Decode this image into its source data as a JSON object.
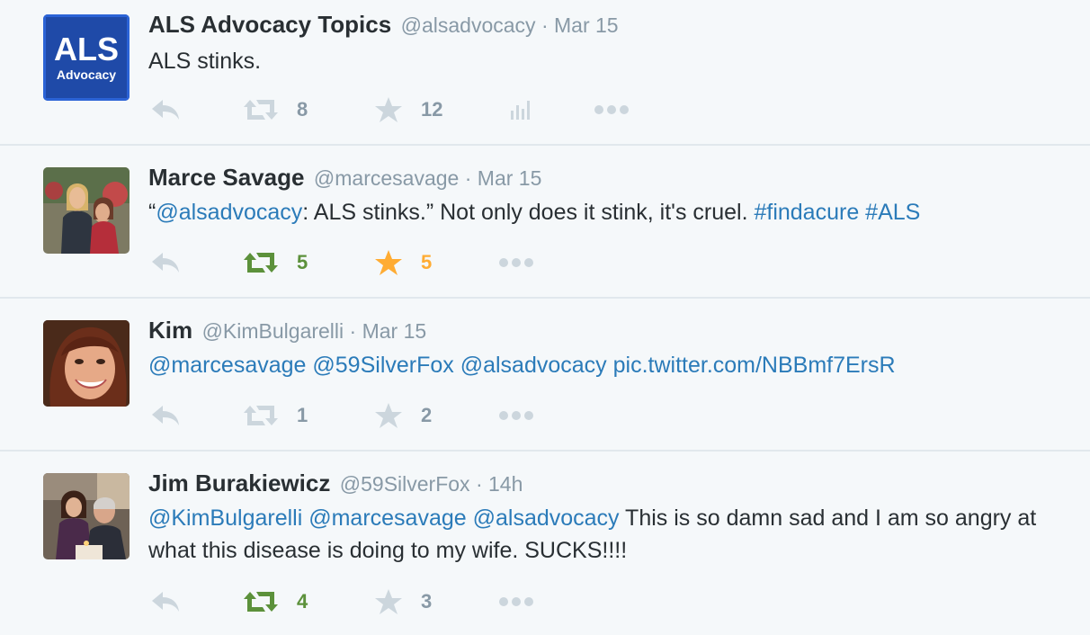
{
  "tweets": [
    {
      "name": "ALS Advocacy Topics",
      "handle": "@alsadvocacy",
      "date": "Mar 15",
      "logo_text": "ALS",
      "logo_subtext": "Advocacy",
      "text": "ALS stinks.",
      "retweets": "8",
      "favorites": "12",
      "retweeted": false,
      "favorited": false
    },
    {
      "name": "Marce Savage",
      "handle": "@marcesavage",
      "date": "Mar 15",
      "text_open_quote": "“",
      "text_mention": "@alsadvocacy",
      "text_mid": ": ALS stinks.” Not only does it stink, it's cruel. ",
      "text_tag1": "#findacure",
      "text_space": " ",
      "text_tag2": "#ALS",
      "retweets": "5",
      "favorites": "5",
      "retweeted": true,
      "favorited": true
    },
    {
      "name": "Kim",
      "handle": "@KimBulgarelli",
      "date": "Mar 15",
      "text_line": "@marcesavage @59SilverFox @alsadvocacy pic.twitter.com/NBBmf7ErsR",
      "retweets": "1",
      "favorites": "2",
      "retweeted": false,
      "favorited": false
    },
    {
      "name": "Jim Burakiewicz",
      "handle": "@59SilverFox",
      "date": "14h",
      "text_mentions": "@KimBulgarelli @marcesavage @alsadvocacy",
      "text_rest": " This is so damn sad and I am so angry at what this disease is doing to my wife. SUCKS!!!!",
      "retweets": "4",
      "favorites": "3",
      "retweeted": true,
      "favorited": false
    }
  ],
  "separator": " · ",
  "colors": {
    "background": "#f5f8fa",
    "link": "#2b7bb9",
    "muted": "#8899a6",
    "retweet_active": "#5c913b",
    "favorite_active": "#ffac33",
    "icon_inactive": "#ccd6dd"
  },
  "icons": [
    "reply-icon",
    "retweet-icon",
    "favorite-star-icon",
    "analytics-icon",
    "more-icon"
  ]
}
